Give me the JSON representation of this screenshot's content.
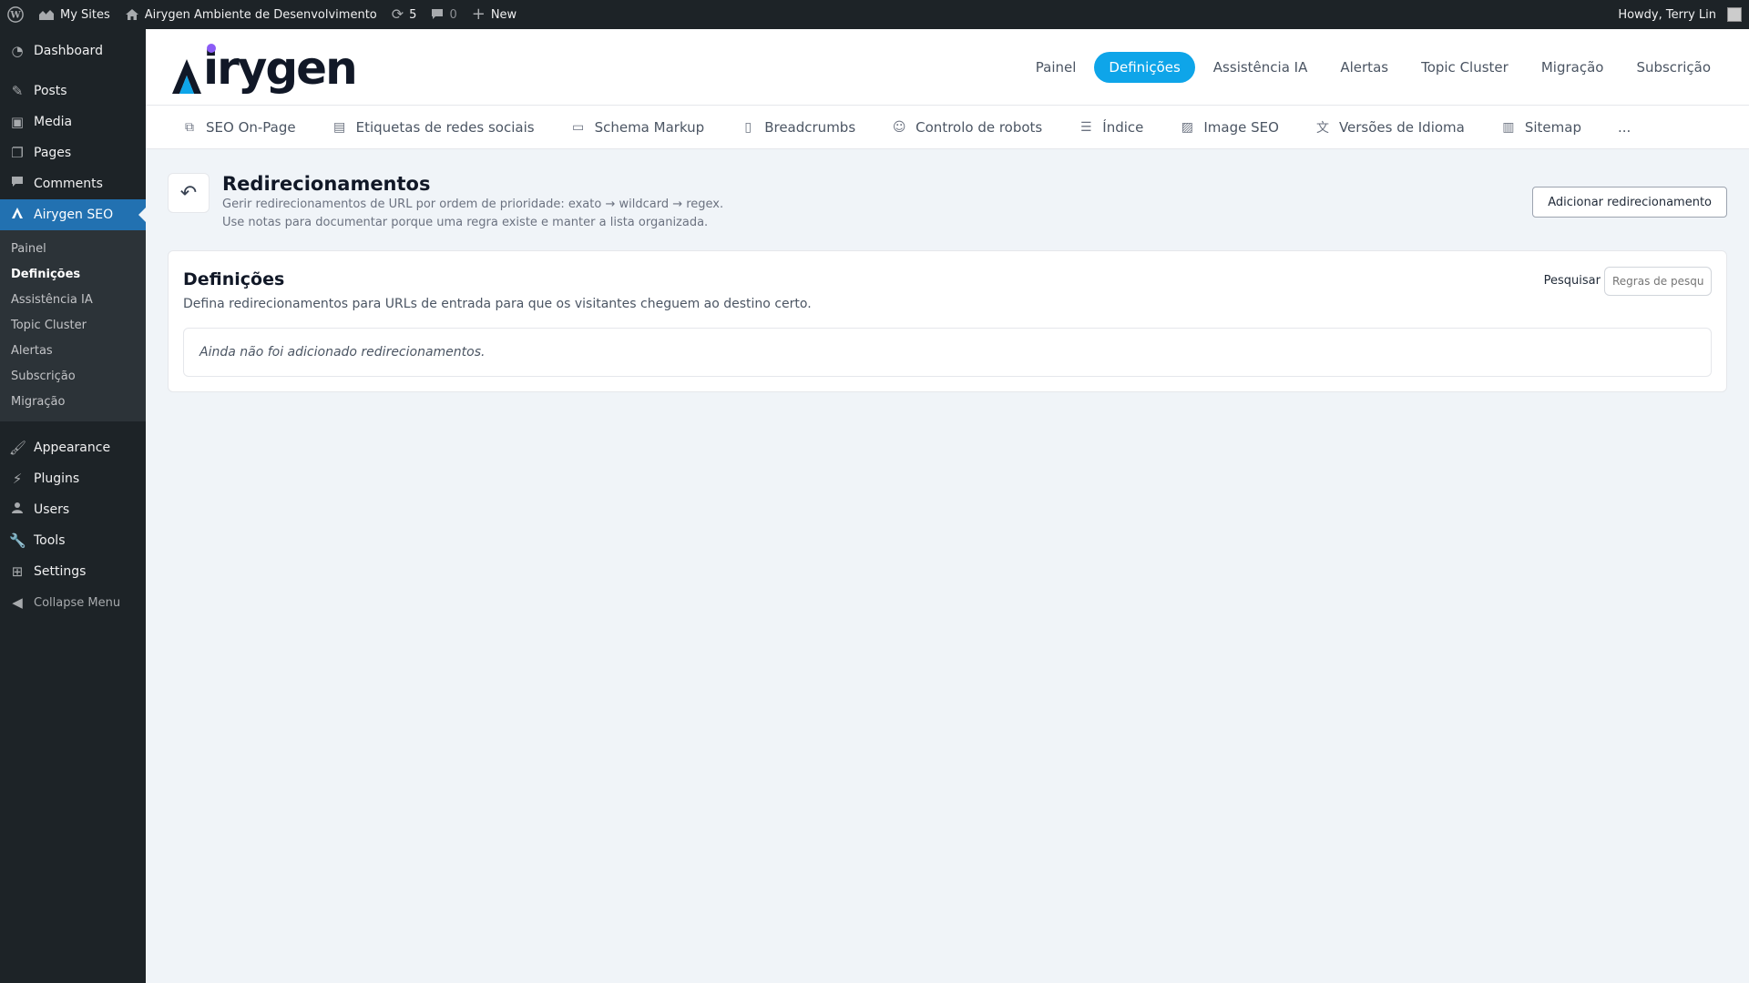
{
  "admin_bar": {
    "my_sites": "My Sites",
    "site_name": "Airygen Ambiente de Desenvolvimento",
    "updates_count": "5",
    "comments_count": "0",
    "new_label": "New",
    "greeting": "Howdy, Terry Lin"
  },
  "sidebar": {
    "dashboard": "Dashboard",
    "posts": "Posts",
    "media": "Media",
    "pages": "Pages",
    "comments": "Comments",
    "airygen_seo": "Airygen SEO",
    "submenu": [
      "Painel",
      "Definições",
      "Assistência IA",
      "Topic Cluster",
      "Alertas",
      "Subscrição",
      "Migração"
    ],
    "appearance": "Appearance",
    "plugins": "Plugins",
    "users": "Users",
    "tools": "Tools",
    "settings": "Settings",
    "collapse": "Collapse Menu"
  },
  "logo_text": "irygen",
  "logo_colors": {
    "a_dark": "#111827",
    "a_blue": "#0ea5e9",
    "dot": "#8b5cf6"
  },
  "main_nav": [
    "Painel",
    "Definições",
    "Assistência IA",
    "Alertas",
    "Topic Cluster",
    "Migração",
    "Subscrição"
  ],
  "sub_nav": [
    {
      "label": "SEO On-Page",
      "icon": "copy-icon"
    },
    {
      "label": "Etiquetas de redes sociais",
      "icon": "card-icon"
    },
    {
      "label": "Schema Markup",
      "icon": "message-icon"
    },
    {
      "label": "Breadcrumbs",
      "icon": "file-icon"
    },
    {
      "label": "Controlo de robots",
      "icon": "robot-icon"
    },
    {
      "label": "Índice",
      "icon": "list-icon"
    },
    {
      "label": "Image SEO",
      "icon": "image-icon"
    },
    {
      "label": "Versões de Idioma",
      "icon": "translate-icon"
    },
    {
      "label": "Sitemap",
      "icon": "map-icon"
    },
    {
      "label": "...",
      "icon": ""
    }
  ],
  "page": {
    "title": "Redirecionamentos",
    "desc1": "Gerir redirecionamentos de URL por ordem de prioridade: exato → wildcard → regex.",
    "desc2": "Use notas para documentar porque uma regra existe e manter a lista organizada.",
    "add_button": "Adicionar redirecionamento"
  },
  "card": {
    "title": "Definições",
    "desc": "Defina redirecionamentos para URLs de entrada para que os visitantes cheguem ao destino certo.",
    "search_label": "Pesquisar",
    "search_placeholder": "Regras de pesqui",
    "empty": "Ainda não foi adicionado redirecionamentos."
  }
}
